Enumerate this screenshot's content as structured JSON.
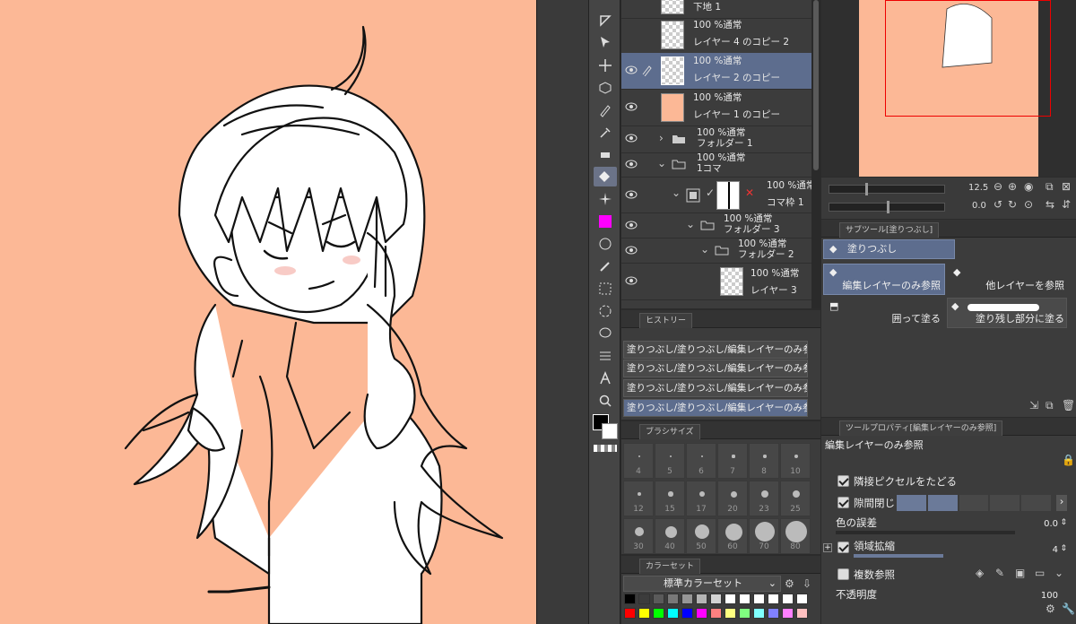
{
  "layers": {
    "rows": [
      {
        "blend": "下地 1",
        "name": ""
      },
      {
        "blend": "100 %通常",
        "name": "レイヤー 4 のコピー 2"
      },
      {
        "blend": "100 %通常",
        "name": "レイヤー 2 のコピー"
      },
      {
        "blend": "100 %通常",
        "name": "レイヤー 1 のコピー"
      },
      {
        "blend": "100 %通常",
        "name": "フォルダー 1"
      },
      {
        "blend": "100 %通常",
        "name": "1コマ"
      },
      {
        "blend": "100 %通常",
        "name": "コマ枠 1"
      },
      {
        "blend": "100 %通常",
        "name": "フォルダー 3"
      },
      {
        "blend": "100 %通常",
        "name": "フォルダー 2"
      },
      {
        "blend": "100 %通常",
        "name": "レイヤー 3"
      }
    ]
  },
  "history": {
    "tab": "ヒストリー",
    "items": [
      "塗りつぶし/塗りつぶし/編集レイヤーのみ参照",
      "塗りつぶし/塗りつぶし/編集レイヤーのみ参照",
      "塗りつぶし/塗りつぶし/編集レイヤーのみ参照",
      "塗りつぶし/塗りつぶし/編集レイヤーのみ参照"
    ]
  },
  "brush": {
    "tab": "ブラシサイズ",
    "sizes": [
      "4",
      "5",
      "6",
      "7",
      "8",
      "10",
      "12",
      "15",
      "17",
      "20",
      "23",
      "25",
      "30",
      "40",
      "50",
      "60",
      "70",
      "80"
    ]
  },
  "colorset": {
    "tab": "カラーセット",
    "selected": "標準カラーセット",
    "swatches": [
      "#000000",
      "#3c3c3c",
      "#5a5a5a",
      "#787878",
      "#969696",
      "#b4b4b4",
      "#d2d2d2",
      "#ffffff",
      "#ffffff",
      "#ffffff",
      "#ffffff",
      "#ffffff",
      "#ffffff",
      "#ff0000",
      "#ffff00",
      "#00ff00",
      "#00ffff",
      "#0000ff",
      "#ff00ff",
      "#ff8080",
      "#ffff80",
      "#80ff80",
      "#80ffff",
      "#8080ff",
      "#ff80ff",
      "#ffc0c0"
    ]
  },
  "navigator": {
    "zoom": "12.5",
    "rotation": "0.0"
  },
  "subtool": {
    "tab": "サブツール[塗りつぶし]",
    "group": "塗りつぶし",
    "items": [
      "編集レイヤーのみ参照",
      "他レイヤーを参照",
      "囲って塗る",
      "塗り残し部分に塗る"
    ]
  },
  "toolprop": {
    "tab": "ツールプロパティ[編集レイヤーのみ参照]",
    "name": "編集レイヤーのみ参照",
    "adjacent_pixels": "隣接ピクセルをたどる",
    "close_gap": "隙間閉じ",
    "color_error_label": "色の誤差",
    "color_error_value": "0.0",
    "area_scaling_label": "領域拡縮",
    "area_scaling_value": "4",
    "multi_ref": "複数参照",
    "opacity_label": "不透明度",
    "opacity_value": "100"
  }
}
